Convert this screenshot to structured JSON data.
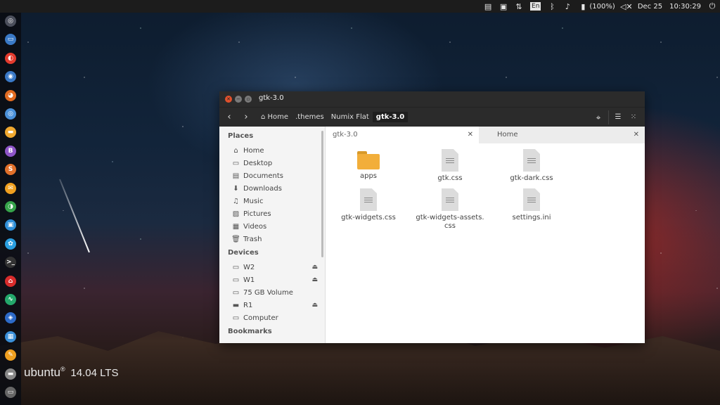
{
  "topbar": {
    "battery": "(100%)",
    "date": "Dec 25",
    "time": "10:30:29",
    "keyboard": "En"
  },
  "desktop": {
    "logo_text": "ubuntu",
    "logo_mark": "®",
    "version": "14.04 LTS"
  },
  "launcher": [
    {
      "name": "dash-icon",
      "color": "#4b4f5c"
    },
    {
      "name": "files-icon",
      "color": "#3a79c6"
    },
    {
      "name": "chrome-icon",
      "color": "#e33b2e"
    },
    {
      "name": "app-icon",
      "color": "#3a79c6"
    },
    {
      "name": "firefox-icon",
      "color": "#e06a20"
    },
    {
      "name": "chromium-icon",
      "color": "#4a90d9"
    },
    {
      "name": "text-editor-icon",
      "color": "#f0a830"
    },
    {
      "name": "writer-icon",
      "color": "#8e55c8"
    },
    {
      "name": "software-center-icon",
      "color": "#e2702a"
    },
    {
      "name": "photo-icon",
      "color": "#f0a020"
    },
    {
      "name": "color-picker-icon",
      "color": "#36a34a"
    },
    {
      "name": "image-viewer-icon",
      "color": "#2f8fd8"
    },
    {
      "name": "settings-icon",
      "color": "#2a9fe0"
    },
    {
      "name": "terminal-icon",
      "color": "#333333"
    },
    {
      "name": "ubuntu-one-icon",
      "color": "#d82c2c"
    },
    {
      "name": "system-monitor-icon",
      "color": "#24a86b"
    },
    {
      "name": "compass-icon",
      "color": "#2d6bc8"
    },
    {
      "name": "calendar-icon",
      "color": "#3a8fd8"
    },
    {
      "name": "utility-icon",
      "color": "#f0a020"
    },
    {
      "name": "drive-icon",
      "color": "#888888"
    },
    {
      "name": "trash-icon",
      "color": "#666666"
    }
  ],
  "window": {
    "title": "gtk-3.0",
    "breadcrumbs": [
      "Home",
      ".themes",
      "Numix Flat",
      "gtk-3.0"
    ],
    "sidebar": {
      "places_header": "Places",
      "places": [
        {
          "label": "Home",
          "icon": "home-icon"
        },
        {
          "label": "Desktop",
          "icon": "desktop-icon"
        },
        {
          "label": "Documents",
          "icon": "documents-icon"
        },
        {
          "label": "Downloads",
          "icon": "downloads-icon"
        },
        {
          "label": "Music",
          "icon": "music-icon"
        },
        {
          "label": "Pictures",
          "icon": "pictures-icon"
        },
        {
          "label": "Videos",
          "icon": "videos-icon"
        },
        {
          "label": "Trash",
          "icon": "trash-icon"
        }
      ],
      "devices_header": "Devices",
      "devices": [
        {
          "label": "W2",
          "eject": true
        },
        {
          "label": "W1",
          "eject": true
        },
        {
          "label": "75 GB Volume",
          "eject": false
        },
        {
          "label": "R1",
          "eject": true
        },
        {
          "label": "Computer",
          "eject": false
        }
      ],
      "bookmarks_header": "Bookmarks"
    },
    "tabs": [
      {
        "label": "gtk-3.0",
        "active": true
      },
      {
        "label": "Home",
        "active": false
      }
    ],
    "files": [
      {
        "label": "apps",
        "type": "folder"
      },
      {
        "label": "gtk.css",
        "type": "file"
      },
      {
        "label": "gtk-dark.css",
        "type": "file"
      },
      {
        "label": "gtk-widgets.css",
        "type": "file"
      },
      {
        "label": "gtk-widgets-assets.",
        "label2": "css",
        "type": "file"
      },
      {
        "label": "settings.ini",
        "type": "file"
      }
    ]
  }
}
